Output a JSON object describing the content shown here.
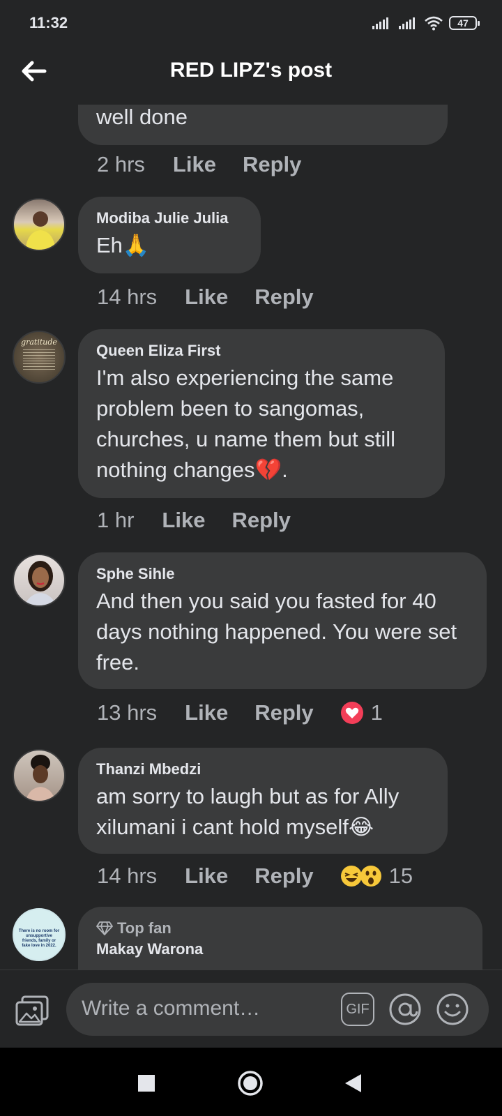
{
  "status": {
    "time": "11:32",
    "battery": "47"
  },
  "header": {
    "title": "RED LIPZ's post"
  },
  "comments": [
    {
      "author": "",
      "text": "well done",
      "time": "2 hrs",
      "like": "Like",
      "reply": "Reply"
    },
    {
      "author": "Modiba Julie Julia",
      "text": "Eh🙏",
      "time": "14 hrs",
      "like": "Like",
      "reply": "Reply"
    },
    {
      "author": "Queen Eliza First",
      "text": "I'm also experiencing the same problem been to sangomas, churches, u name them but still nothing changes💔.",
      "time": "1 hr",
      "like": "Like",
      "reply": "Reply"
    },
    {
      "author": "Sphe Sihle",
      "text": "And then you said you fasted for 40 days nothing happened. You were set free.",
      "time": "13 hrs",
      "like": "Like",
      "reply": "Reply",
      "reaction_count": "1"
    },
    {
      "author": "Thanzi Mbedzi",
      "text": "am sorry to laugh but as for Ally xilumani i cant hold myself😂",
      "time": "14 hrs",
      "like": "Like",
      "reply": "Reply",
      "reaction_count": "15"
    },
    {
      "badge": "Top fan",
      "author": "Makay Warona"
    }
  ],
  "avatar_texts": {
    "queen": "gratitude",
    "last": "There is no room for unsupportive friends, family or fake love in 2022."
  },
  "composer": {
    "placeholder": "Write a comment…",
    "gif": "GIF"
  },
  "colors": {
    "background": "#242526",
    "bubble": "#3a3b3c",
    "meta": "#b0b3b8",
    "love": "#f33e58"
  }
}
